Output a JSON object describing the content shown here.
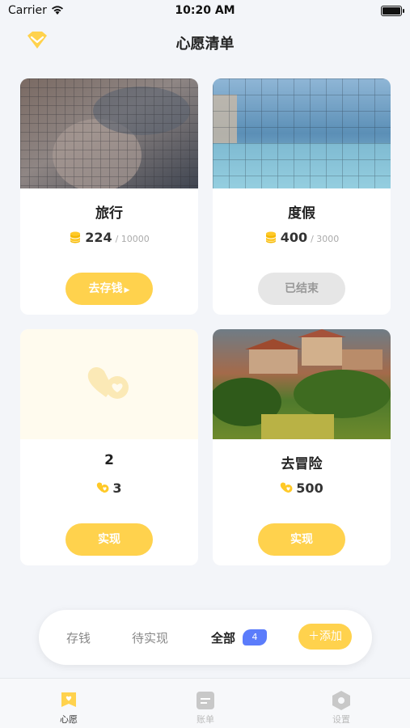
{
  "status_bar": {
    "carrier": "Carrier",
    "time": "10:20 AM"
  },
  "nav": {
    "title": "心愿清单",
    "vip_icon": "diamond-icon"
  },
  "wishes": [
    {
      "name": "旅行",
      "saved": "224",
      "target": "/ 10000",
      "button": "去存钱",
      "state": "saving",
      "icon": "coin-stack-icon"
    },
    {
      "name": "度假",
      "saved": "400",
      "target": "/ 3000",
      "button": "已结束",
      "state": "ended",
      "icon": "coin-stack-icon"
    },
    {
      "name": "2",
      "saved": "3",
      "target": "",
      "button": "实现",
      "state": "wish",
      "icon": "heart-coin-icon"
    },
    {
      "name": "去冒险",
      "saved": "500",
      "target": "",
      "button": "实现",
      "state": "wish",
      "icon": "heart-coin-icon"
    }
  ],
  "filter": {
    "tabs": [
      "存钱",
      "待实现",
      "全部"
    ],
    "active": "全部",
    "count": "4",
    "add_label": "添加"
  },
  "tab_bar": [
    {
      "label": "心愿",
      "icon": "wish-icon",
      "active": true
    },
    {
      "label": "账单",
      "icon": "bill-icon",
      "active": false
    },
    {
      "label": "设置",
      "icon": "settings-icon",
      "active": false
    }
  ],
  "colors": {
    "accent": "#ffd24d",
    "badge": "#5b7cfb",
    "background": "#f3f5f9"
  }
}
